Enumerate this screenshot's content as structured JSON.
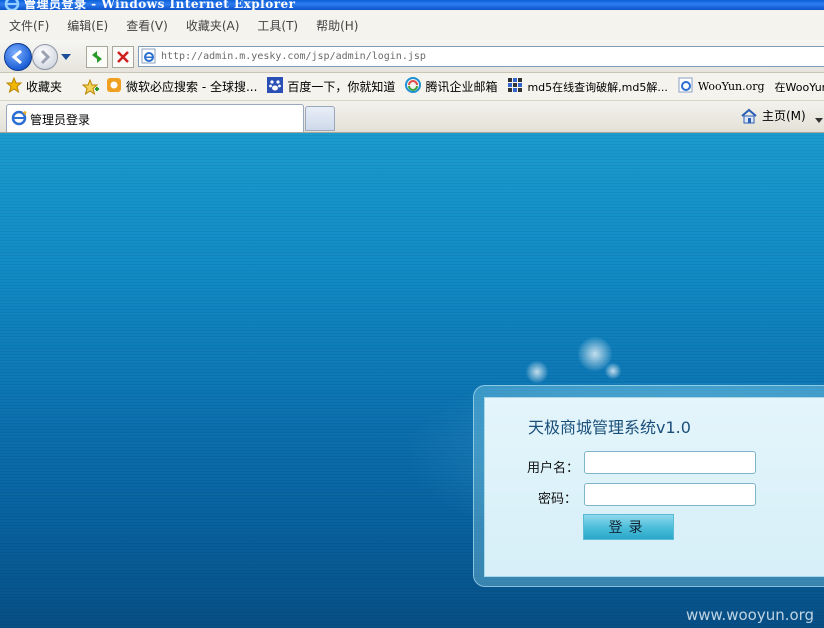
{
  "window": {
    "title": "管理员登录 - Windows Internet Explorer"
  },
  "menu": {
    "items": [
      "文件(F)",
      "编辑(E)",
      "查看(V)",
      "收藏夹(A)",
      "工具(T)",
      "帮助(H)"
    ]
  },
  "navigation": {
    "address_url": "http://admin.m.yesky.com/jsp/admin/login.jsp"
  },
  "favorites": {
    "label": "收藏夹",
    "items": [
      {
        "label": "微软必应搜索 - 全球搜...",
        "icon": "bing-icon"
      },
      {
        "label": "百度一下，你就知道",
        "icon": "baidu-paw-icon"
      },
      {
        "label": "腾讯企业邮箱",
        "icon": "tencent-icon"
      },
      {
        "label": "md5在线查询破解,md5解...",
        "icon": "grid-icon"
      },
      {
        "label": "WooYun.org",
        "icon": "ie-page-icon"
      },
      {
        "label": "在WooYun",
        "icon": ""
      }
    ]
  },
  "tabs": {
    "active_label": "管理员登录",
    "home_label": "主页(M)"
  },
  "login": {
    "title": "天极商城管理系统v1.0",
    "username_label": "用户名：",
    "password_label": "密码：",
    "username_value": "",
    "password_value": "",
    "submit_label": "登录"
  },
  "watermark": "www.wooyun.org",
  "colors": {
    "accent": "#1a4f7a",
    "page_bg_top": "#1b9bd0",
    "page_bg_bottom": "#074f86",
    "button": "#48bcd9"
  }
}
